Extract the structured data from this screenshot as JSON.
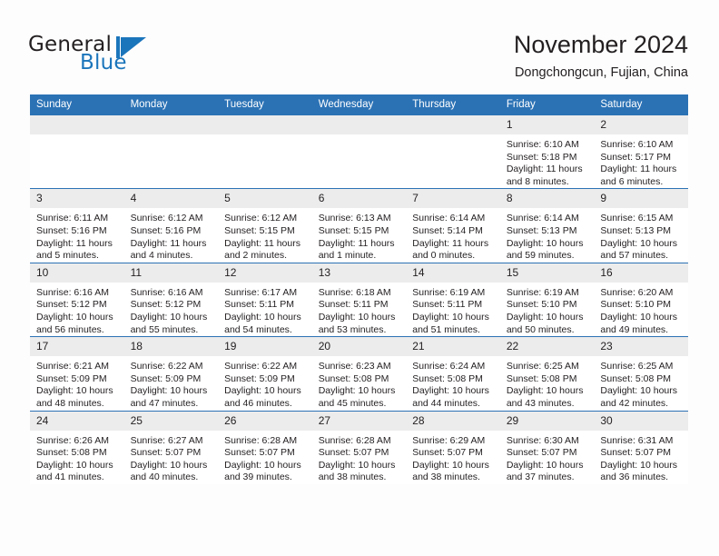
{
  "brand": {
    "name_part1": "General",
    "name_part2": "Blue",
    "flag_icon": "general-blue-flag-icon",
    "accent_color": "#1b75bb"
  },
  "header": {
    "title": "November 2024",
    "subtitle": "Dongchongcun, Fujian, China"
  },
  "theme": {
    "header_band": "#2b72b5",
    "daynum_strip": "#ececec",
    "text": "#231f20",
    "page_background": "#fdfdfd"
  },
  "weekday_headers": [
    "Sunday",
    "Monday",
    "Tuesday",
    "Wednesday",
    "Thursday",
    "Friday",
    "Saturday"
  ],
  "weeks": [
    [
      {
        "day": "",
        "lines": []
      },
      {
        "day": "",
        "lines": []
      },
      {
        "day": "",
        "lines": []
      },
      {
        "day": "",
        "lines": []
      },
      {
        "day": "",
        "lines": []
      },
      {
        "day": "1",
        "lines": [
          "Sunrise: 6:10 AM",
          "Sunset: 5:18 PM",
          "Daylight: 11 hours",
          "and 8 minutes."
        ]
      },
      {
        "day": "2",
        "lines": [
          "Sunrise: 6:10 AM",
          "Sunset: 5:17 PM",
          "Daylight: 11 hours",
          "and 6 minutes."
        ]
      }
    ],
    [
      {
        "day": "3",
        "lines": [
          "Sunrise: 6:11 AM",
          "Sunset: 5:16 PM",
          "Daylight: 11 hours",
          "and 5 minutes."
        ]
      },
      {
        "day": "4",
        "lines": [
          "Sunrise: 6:12 AM",
          "Sunset: 5:16 PM",
          "Daylight: 11 hours",
          "and 4 minutes."
        ]
      },
      {
        "day": "5",
        "lines": [
          "Sunrise: 6:12 AM",
          "Sunset: 5:15 PM",
          "Daylight: 11 hours",
          "and 2 minutes."
        ]
      },
      {
        "day": "6",
        "lines": [
          "Sunrise: 6:13 AM",
          "Sunset: 5:15 PM",
          "Daylight: 11 hours",
          "and 1 minute."
        ]
      },
      {
        "day": "7",
        "lines": [
          "Sunrise: 6:14 AM",
          "Sunset: 5:14 PM",
          "Daylight: 11 hours",
          "and 0 minutes."
        ]
      },
      {
        "day": "8",
        "lines": [
          "Sunrise: 6:14 AM",
          "Sunset: 5:13 PM",
          "Daylight: 10 hours",
          "and 59 minutes."
        ]
      },
      {
        "day": "9",
        "lines": [
          "Sunrise: 6:15 AM",
          "Sunset: 5:13 PM",
          "Daylight: 10 hours",
          "and 57 minutes."
        ]
      }
    ],
    [
      {
        "day": "10",
        "lines": [
          "Sunrise: 6:16 AM",
          "Sunset: 5:12 PM",
          "Daylight: 10 hours",
          "and 56 minutes."
        ]
      },
      {
        "day": "11",
        "lines": [
          "Sunrise: 6:16 AM",
          "Sunset: 5:12 PM",
          "Daylight: 10 hours",
          "and 55 minutes."
        ]
      },
      {
        "day": "12",
        "lines": [
          "Sunrise: 6:17 AM",
          "Sunset: 5:11 PM",
          "Daylight: 10 hours",
          "and 54 minutes."
        ]
      },
      {
        "day": "13",
        "lines": [
          "Sunrise: 6:18 AM",
          "Sunset: 5:11 PM",
          "Daylight: 10 hours",
          "and 53 minutes."
        ]
      },
      {
        "day": "14",
        "lines": [
          "Sunrise: 6:19 AM",
          "Sunset: 5:11 PM",
          "Daylight: 10 hours",
          "and 51 minutes."
        ]
      },
      {
        "day": "15",
        "lines": [
          "Sunrise: 6:19 AM",
          "Sunset: 5:10 PM",
          "Daylight: 10 hours",
          "and 50 minutes."
        ]
      },
      {
        "day": "16",
        "lines": [
          "Sunrise: 6:20 AM",
          "Sunset: 5:10 PM",
          "Daylight: 10 hours",
          "and 49 minutes."
        ]
      }
    ],
    [
      {
        "day": "17",
        "lines": [
          "Sunrise: 6:21 AM",
          "Sunset: 5:09 PM",
          "Daylight: 10 hours",
          "and 48 minutes."
        ]
      },
      {
        "day": "18",
        "lines": [
          "Sunrise: 6:22 AM",
          "Sunset: 5:09 PM",
          "Daylight: 10 hours",
          "and 47 minutes."
        ]
      },
      {
        "day": "19",
        "lines": [
          "Sunrise: 6:22 AM",
          "Sunset: 5:09 PM",
          "Daylight: 10 hours",
          "and 46 minutes."
        ]
      },
      {
        "day": "20",
        "lines": [
          "Sunrise: 6:23 AM",
          "Sunset: 5:08 PM",
          "Daylight: 10 hours",
          "and 45 minutes."
        ]
      },
      {
        "day": "21",
        "lines": [
          "Sunrise: 6:24 AM",
          "Sunset: 5:08 PM",
          "Daylight: 10 hours",
          "and 44 minutes."
        ]
      },
      {
        "day": "22",
        "lines": [
          "Sunrise: 6:25 AM",
          "Sunset: 5:08 PM",
          "Daylight: 10 hours",
          "and 43 minutes."
        ]
      },
      {
        "day": "23",
        "lines": [
          "Sunrise: 6:25 AM",
          "Sunset: 5:08 PM",
          "Daylight: 10 hours",
          "and 42 minutes."
        ]
      }
    ],
    [
      {
        "day": "24",
        "lines": [
          "Sunrise: 6:26 AM",
          "Sunset: 5:08 PM",
          "Daylight: 10 hours",
          "and 41 minutes."
        ]
      },
      {
        "day": "25",
        "lines": [
          "Sunrise: 6:27 AM",
          "Sunset: 5:07 PM",
          "Daylight: 10 hours",
          "and 40 minutes."
        ]
      },
      {
        "day": "26",
        "lines": [
          "Sunrise: 6:28 AM",
          "Sunset: 5:07 PM",
          "Daylight: 10 hours",
          "and 39 minutes."
        ]
      },
      {
        "day": "27",
        "lines": [
          "Sunrise: 6:28 AM",
          "Sunset: 5:07 PM",
          "Daylight: 10 hours",
          "and 38 minutes."
        ]
      },
      {
        "day": "28",
        "lines": [
          "Sunrise: 6:29 AM",
          "Sunset: 5:07 PM",
          "Daylight: 10 hours",
          "and 38 minutes."
        ]
      },
      {
        "day": "29",
        "lines": [
          "Sunrise: 6:30 AM",
          "Sunset: 5:07 PM",
          "Daylight: 10 hours",
          "and 37 minutes."
        ]
      },
      {
        "day": "30",
        "lines": [
          "Sunrise: 6:31 AM",
          "Sunset: 5:07 PM",
          "Daylight: 10 hours",
          "and 36 minutes."
        ]
      }
    ]
  ]
}
